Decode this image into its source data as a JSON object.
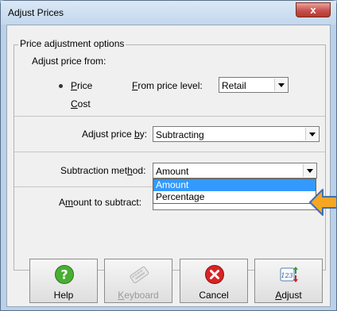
{
  "window": {
    "title": "Adjust Prices",
    "close_glyph": "x"
  },
  "group_title": "Price adjustment options",
  "adjust_from": {
    "label": "Adjust price from:",
    "options": [
      {
        "label_ul": "P",
        "label_rest": "rice",
        "selected": true
      },
      {
        "label_ul": "C",
        "label_rest": "ost",
        "selected": false
      }
    ]
  },
  "from_price_level": {
    "label_ul": "F",
    "label_rest": "rom price level:",
    "value": "Retail"
  },
  "adjust_by": {
    "label_pre": "Adjust price ",
    "label_ul": "b",
    "label_rest": "y:",
    "value": "Subtracting"
  },
  "subtraction_method": {
    "label_pre": "Subtraction met",
    "label_ul": "h",
    "label_rest": "od:",
    "value": "Amount",
    "options": [
      "Amount",
      "Percentage"
    ],
    "highlighted": "Amount"
  },
  "amount": {
    "label_pre": "A",
    "label_ul": "m",
    "label_rest": "ount to subtract:",
    "value": ""
  },
  "buttons": [
    {
      "label_pre": "",
      "label_ul": "",
      "label_rest": "Help",
      "icon": "help-icon",
      "enabled": true
    },
    {
      "label_pre": "",
      "label_ul": "K",
      "label_rest": "eyboard",
      "icon": "keyboard-icon",
      "enabled": false
    },
    {
      "label_pre": "",
      "label_ul": "",
      "label_rest": "Cancel",
      "icon": "cancel-icon",
      "enabled": true
    },
    {
      "label_pre": "",
      "label_ul": "A",
      "label_rest": "djust",
      "icon": "adjust-icon",
      "enabled": true
    }
  ],
  "colors": {
    "highlight": "#3399ff",
    "pointer": "#f5a623",
    "help": "#3f9d2c",
    "cancel": "#d42020"
  }
}
